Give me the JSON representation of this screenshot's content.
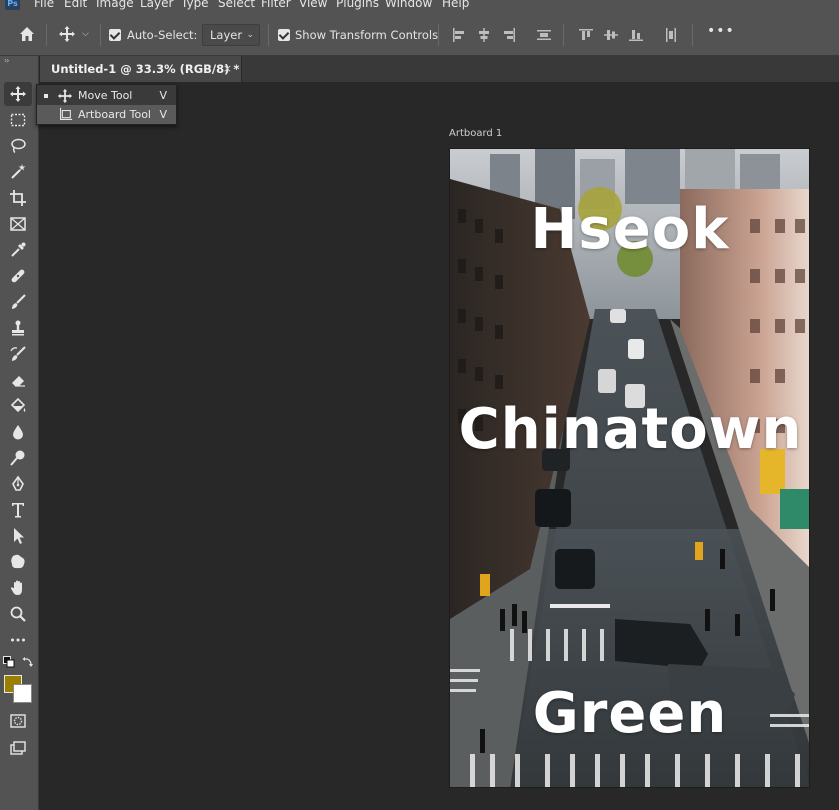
{
  "app": {
    "logo": "Ps"
  },
  "menu": [
    "File",
    "Edit",
    "Image",
    "Layer",
    "Type",
    "Select",
    "Filter",
    "View",
    "Plugins",
    "Window",
    "Help"
  ],
  "options_bar": {
    "home_icon": "home-icon",
    "move_tool_icon": "move-icon",
    "auto_select_label": "Auto-Select:",
    "auto_select_checked": true,
    "auto_select_target": "Layer",
    "show_transform_label": "Show Transform Controls",
    "show_transform_checked": true,
    "more_label": "•••"
  },
  "toolbar": {
    "grip": "››",
    "tools": [
      "move",
      "marquee",
      "lasso",
      "magic-wand",
      "crop",
      "frame",
      "eyedropper",
      "healing",
      "brush",
      "stamp",
      "history-brush",
      "eraser",
      "paint-bucket",
      "blur",
      "dodge",
      "pen",
      "type",
      "path-selection",
      "shape",
      "hand",
      "zoom",
      "more",
      "quick-mask",
      "screen-mode"
    ],
    "foreground_color": "#9a7f00",
    "background_color": "#ffffff"
  },
  "document_tab": {
    "title": "Untitled-1 @ 33.3% (RGB/8) *",
    "close": "×"
  },
  "flyout": {
    "items": [
      {
        "label": "Move Tool",
        "shortcut": "V",
        "selected": true
      },
      {
        "label": "Artboard Tool",
        "shortcut": "V",
        "selected": false
      }
    ]
  },
  "artboard": {
    "label": "Artboard 1",
    "texts": [
      "Hseok",
      "Chinatown",
      "Green"
    ]
  }
}
